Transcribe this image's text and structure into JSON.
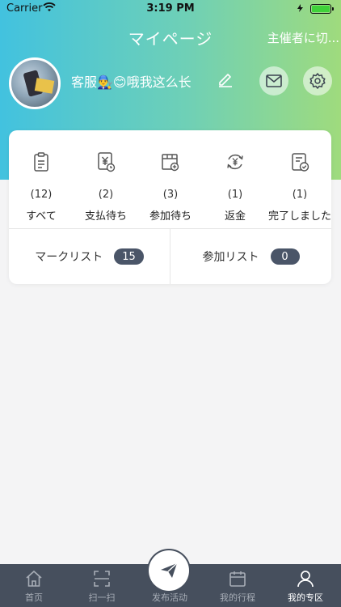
{
  "status_bar": {
    "carrier": "Carrier",
    "time": "3:19 PM"
  },
  "header": {
    "title": "マイページ",
    "switch_label": "主催者に切...",
    "username": "客服👨‍🔧😊哦我这么长"
  },
  "orders": [
    {
      "count": "(12)",
      "label": "すべて",
      "icon": "clipboard-icon"
    },
    {
      "count": "(2)",
      "label": "支払待ち",
      "icon": "pay-icon"
    },
    {
      "count": "(3)",
      "label": "参加待ち",
      "icon": "join-icon"
    },
    {
      "count": "(1)",
      "label": "返金",
      "icon": "refund-icon"
    },
    {
      "count": "(1)",
      "label": "完了しました",
      "icon": "complete-icon"
    }
  ],
  "lists": {
    "mark": {
      "label": "マークリスト",
      "count": "15"
    },
    "join": {
      "label": "参加リスト",
      "count": "0"
    }
  },
  "tabs": [
    {
      "label": "首页",
      "icon": "home-icon"
    },
    {
      "label": "扫一扫",
      "icon": "scan-icon"
    },
    {
      "label": "发布活动",
      "icon": "send-icon"
    },
    {
      "label": "我的行程",
      "icon": "calendar-icon"
    },
    {
      "label": "我的专区",
      "icon": "person-icon",
      "active": true
    }
  ],
  "colors": {
    "accent_dark": "#464f5d",
    "gradient_start": "#42c2df",
    "gradient_end": "#9fdb7d",
    "battery": "#3fd13a"
  }
}
